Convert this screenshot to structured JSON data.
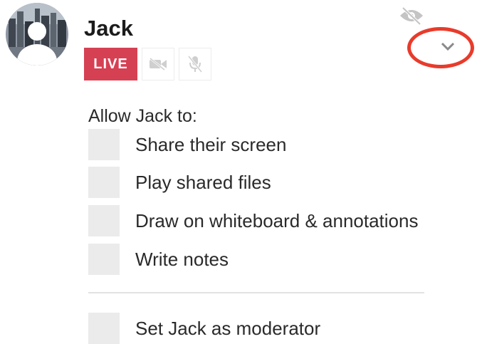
{
  "user": {
    "name": "Jack",
    "live_label": "LIVE"
  },
  "icons": {
    "hide": "eye-slash-icon",
    "camera": "camera-off-icon",
    "microphone": "microphone-off-icon",
    "expand": "chevron-down-icon"
  },
  "colors": {
    "live_badge": "#d64053",
    "highlight_ring": "#e83b2b",
    "checkbox": "#ebebeb",
    "muted_icon": "#cfcfcf"
  },
  "permissions": {
    "heading": "Allow Jack to:",
    "items": [
      {
        "label": "Share their screen",
        "checked": false
      },
      {
        "label": "Play shared files",
        "checked": false
      },
      {
        "label": "Draw on whiteboard & annotations",
        "checked": false
      },
      {
        "label": "Write notes",
        "checked": false
      }
    ],
    "moderator": {
      "label": "Set Jack as moderator",
      "checked": false
    }
  }
}
